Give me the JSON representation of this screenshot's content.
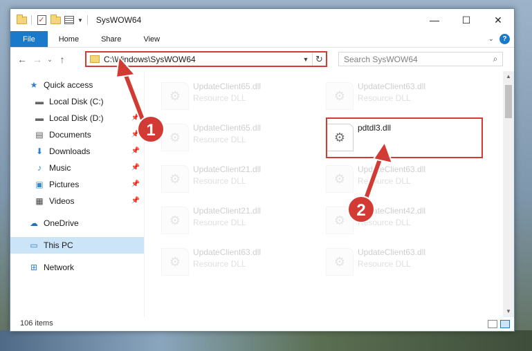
{
  "window": {
    "title": "SysWOW64"
  },
  "title_buttons": {
    "minimize": "—",
    "maximize": "☐",
    "close": "✕"
  },
  "ribbon": {
    "tabs": [
      "File",
      "Home",
      "Share",
      "View"
    ]
  },
  "address": {
    "path": "C:\\Windows\\SysWOW64"
  },
  "search": {
    "placeholder": "Search SysWOW64"
  },
  "nav": {
    "items": [
      {
        "label": "Quick access",
        "icon": "star-icon"
      },
      {
        "label": "Local Disk (C:)",
        "icon": "drive-icon"
      },
      {
        "label": "Local Disk (D:)",
        "icon": "drive-icon"
      },
      {
        "label": "Documents",
        "icon": "documents-icon"
      },
      {
        "label": "Downloads",
        "icon": "download-icon"
      },
      {
        "label": "Music",
        "icon": "music-icon"
      },
      {
        "label": "Pictures",
        "icon": "pictures-icon"
      },
      {
        "label": "Videos",
        "icon": "videos-icon"
      },
      {
        "label": "OneDrive",
        "icon": "cloud-icon"
      },
      {
        "label": "This PC",
        "icon": "computer-icon"
      },
      {
        "label": "Network",
        "icon": "network-icon"
      }
    ]
  },
  "files": [
    {
      "name": "UpdateClient65.dll",
      "type": "Resource DLL"
    },
    {
      "name": "UpdateClient63.dll",
      "type": "Resource DLL"
    },
    {
      "name": "UpdateClient65.dll",
      "type": "Resource DLL"
    },
    {
      "name": "pdtdl3.dll",
      "type": ""
    },
    {
      "name": "UpdateClient21.dll",
      "type": "Resource DLL"
    },
    {
      "name": "UpdateClient63.dll",
      "type": "Resource DLL"
    },
    {
      "name": "UpdateClient21.dll",
      "type": "Resource DLL"
    },
    {
      "name": "UpdateClient42.dll",
      "type": "Resource DLL"
    },
    {
      "name": "UpdateClient63.dll",
      "type": "Resource DLL"
    },
    {
      "name": "UpdateClient63.dll",
      "type": "Resource DLL"
    }
  ],
  "status": {
    "count": "106 items"
  },
  "annotations": {
    "step1": "1",
    "step2": "2",
    "color": "#d23a34"
  }
}
